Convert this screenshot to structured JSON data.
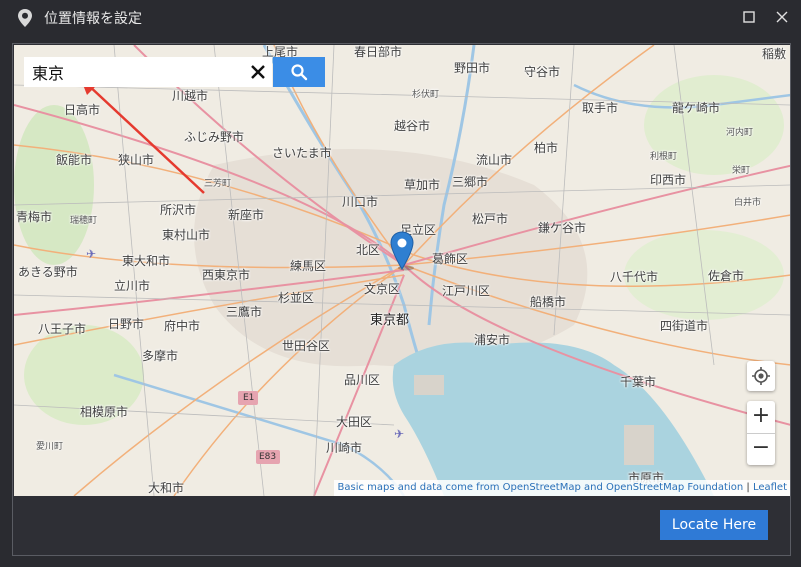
{
  "window": {
    "title": "位置情報を設定",
    "icon": "location-pin-icon",
    "controls": [
      "maximize-icon",
      "close-icon"
    ]
  },
  "search": {
    "value": "東京",
    "clear_icon": "close-x-icon",
    "button_icon": "search-icon"
  },
  "map": {
    "labels": {
      "l1": "春日部市",
      "l2": "上尾市",
      "l3": "野田市",
      "l4": "守谷市",
      "l5": "稲敷",
      "l6": "川越市",
      "l7": "越谷市",
      "l8": "取手市",
      "l9": "龍ケ崎市",
      "l10": "日高市",
      "l11": "ふじみ野市",
      "l12": "さいたま市",
      "l13": "流山市",
      "l14": "柏市",
      "l15": "飯能市",
      "l16": "狭山市",
      "l17": "三芳町",
      "l18": "草加市",
      "l19": "三郷市",
      "l20": "印西市",
      "l21": "青梅市",
      "l22": "瑞穂町",
      "l23": "所沢市",
      "l24": "新座市",
      "l25": "川口市",
      "l26": "松戸市",
      "l27": "鎌ケ谷市",
      "l28": "東村山市",
      "l29": "足立区",
      "l30": "北区",
      "l31": "葛飾区",
      "l32": "あきる野市",
      "l33": "東大和市",
      "l34": "西東京市",
      "l35": "練馬区",
      "l36": "八千代市",
      "l37": "佐倉市",
      "l38": "立川市",
      "l39": "文京区",
      "l40": "江戸川区",
      "l41": "杉並区",
      "l42": "船橋市",
      "l43": "八王子市",
      "l44": "日野市",
      "l45": "府中市",
      "l46": "三鷹市",
      "l47": "東京都",
      "l48": "四街道市",
      "l49": "多摩市",
      "l50": "世田谷区",
      "l51": "浦安市",
      "l52": "品川区",
      "l53": "千葉市",
      "l54": "相模原市",
      "l55": "大田区",
      "l56": "愛川町",
      "l57": "川崎市",
      "l58": "大和市",
      "l59": "市原市",
      "l60": "利根町",
      "l61": "杉伏町",
      "l62": "河内町",
      "l63": "栄町",
      "l64": "白井市",
      "l65": "E1",
      "l66": "E83"
    },
    "zoom_in": "+",
    "zoom_out": "−",
    "locate_icon": "geolocate-icon",
    "marker_icon": "map-marker-icon"
  },
  "attribution": {
    "text": "Basic maps and data come from OpenStreetMap and OpenStreetMap Foundation",
    "sep": " | ",
    "leaflet": "Leaflet"
  },
  "footer": {
    "locate_label": "Locate Here"
  }
}
